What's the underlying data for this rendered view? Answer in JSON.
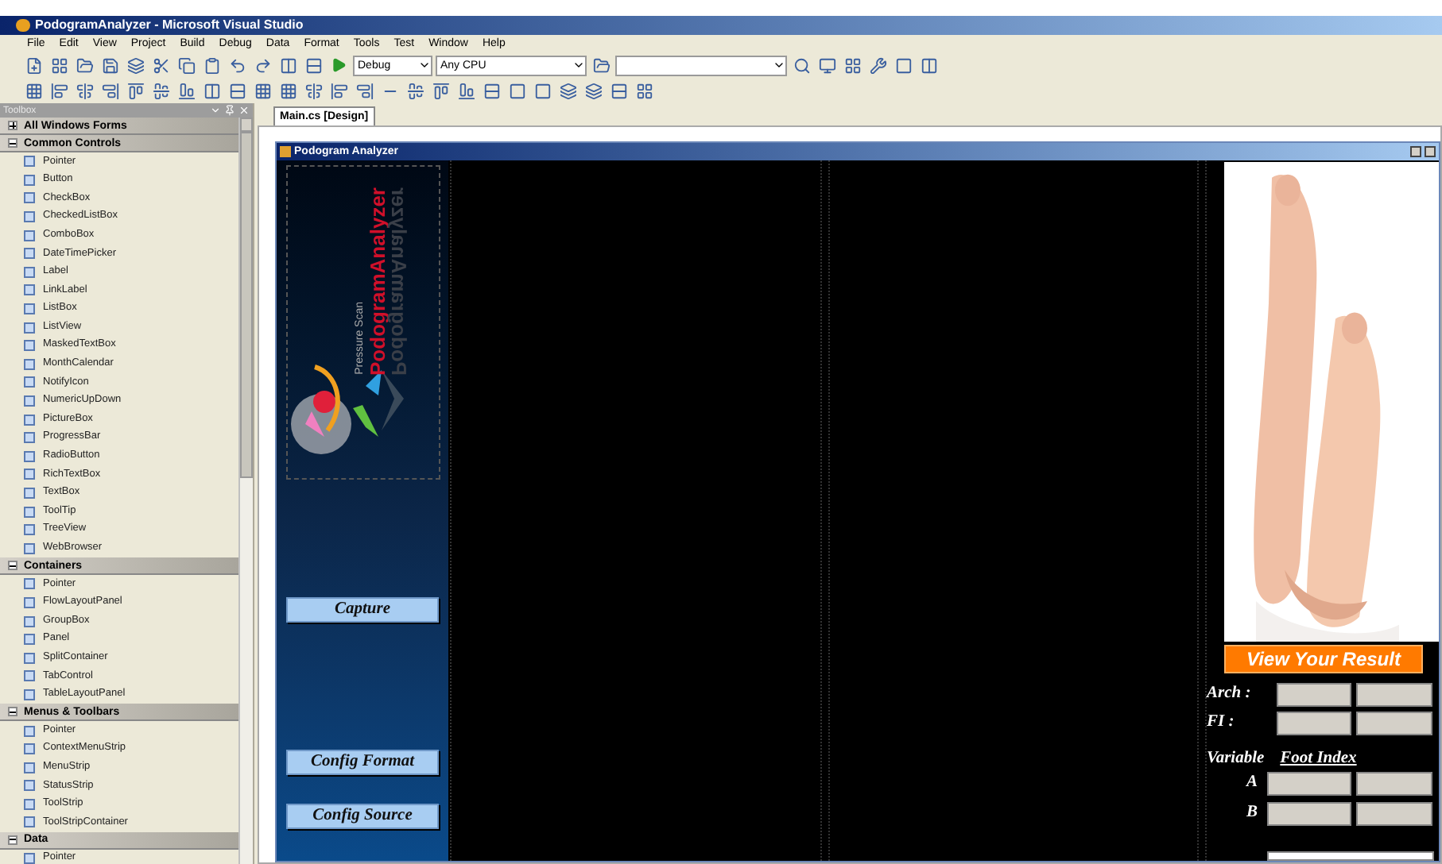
{
  "window": {
    "title": "PodogramAnalyzer - Microsoft Visual Studio"
  },
  "menu": [
    "File",
    "Edit",
    "View",
    "Project",
    "Build",
    "Debug",
    "Data",
    "Format",
    "Tools",
    "Test",
    "Window",
    "Help"
  ],
  "toolbar": {
    "configuration": "Debug",
    "platform": "Any CPU"
  },
  "toolbox": {
    "title": "Toolbox",
    "sections": [
      {
        "label": "All Windows Forms",
        "expanded": false
      },
      {
        "label": "Common Controls",
        "expanded": true,
        "items": [
          "Pointer",
          "Button",
          "CheckBox",
          "CheckedListBox",
          "ComboBox",
          "DateTimePicker",
          "Label",
          "LinkLabel",
          "ListBox",
          "ListView",
          "MaskedTextBox",
          "MonthCalendar",
          "NotifyIcon",
          "NumericUpDown",
          "PictureBox",
          "ProgressBar",
          "RadioButton",
          "RichTextBox",
          "TextBox",
          "ToolTip",
          "TreeView",
          "WebBrowser"
        ]
      },
      {
        "label": "Containers",
        "expanded": true,
        "items": [
          "Pointer",
          "FlowLayoutPanel",
          "GroupBox",
          "Panel",
          "SplitContainer",
          "TabControl",
          "TableLayoutPanel"
        ]
      },
      {
        "label": "Menus & Toolbars",
        "expanded": true,
        "items": [
          "Pointer",
          "ContextMenuStrip",
          "MenuStrip",
          "StatusStrip",
          "ToolStrip",
          "ToolStripContainer"
        ]
      },
      {
        "label": "Data",
        "expanded": true,
        "items": [
          "Pointer"
        ]
      }
    ]
  },
  "document_tab": {
    "label": "Main.cs [Design]",
    "selected": true
  },
  "form": {
    "title": "Podogram Analyzer",
    "logo": {
      "subtitle": "Pressure Scan",
      "name": "PodogramAnalyzer",
      "reflection": "PodogramAnalyzer"
    },
    "buttons": [
      "Capture",
      "Config Format",
      "Config Source"
    ],
    "result_button": "View Your Result",
    "result_rows": [
      "Arch :",
      "FI :"
    ],
    "variable_heading": "Variable",
    "foot_index_heading": "Foot Index",
    "variables": [
      "A",
      "B"
    ]
  }
}
